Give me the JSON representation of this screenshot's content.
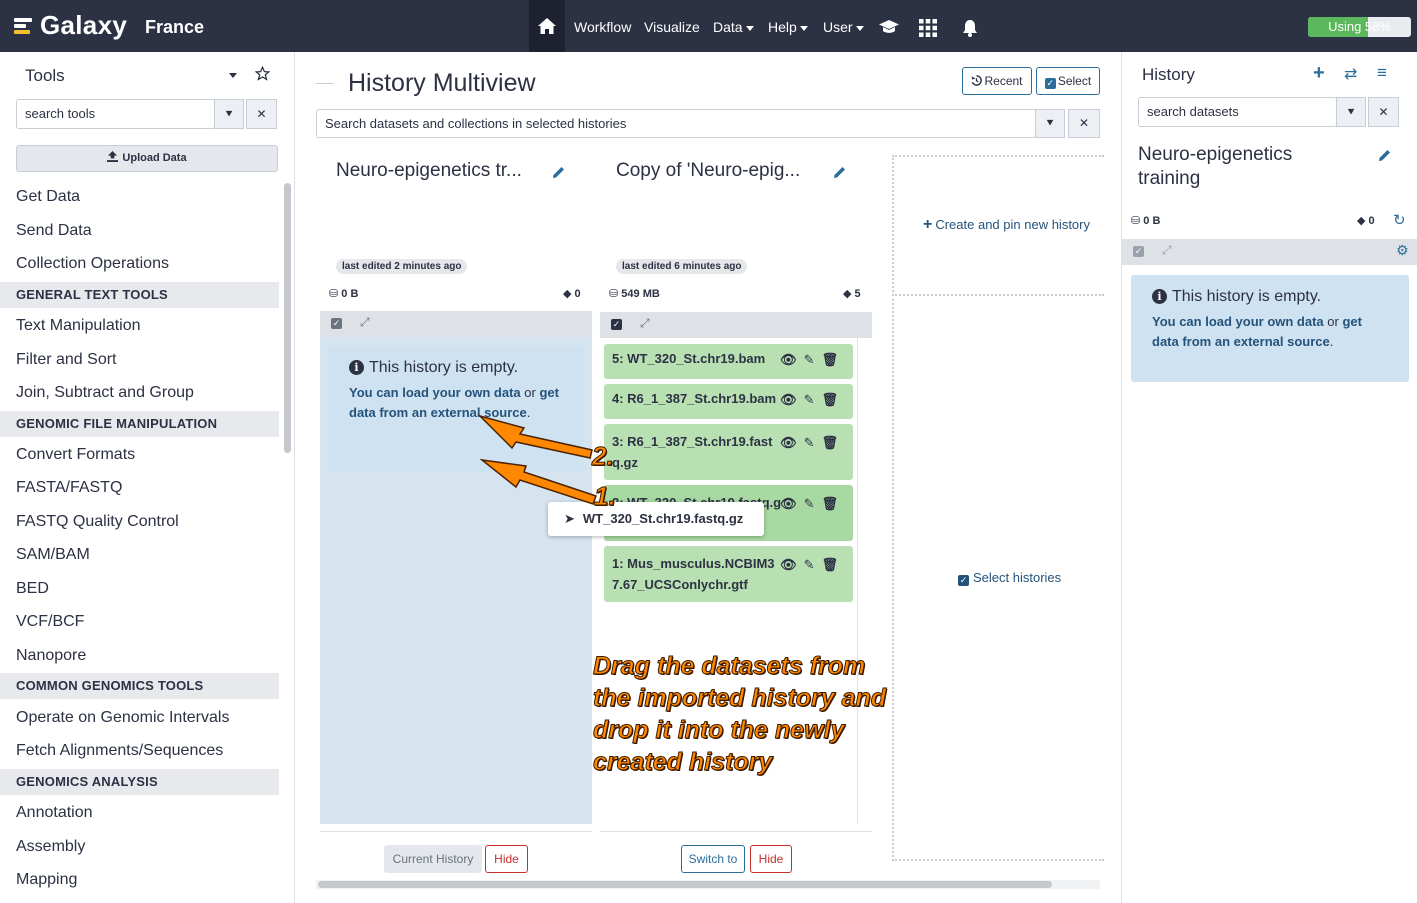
{
  "navbar": {
    "brand": "Galaxy",
    "subsite": "France",
    "menu": [
      "Workflow",
      "Visualize",
      "Data",
      "Help",
      "User"
    ],
    "usage_label": "Using 58%",
    "usage_fraction": 0.58
  },
  "tools": {
    "title": "Tools",
    "search_value": "search tools",
    "upload_label": "Upload Data",
    "items_top": [
      "Get Data",
      "Send Data",
      "Collection Operations"
    ],
    "section1": "GENERAL TEXT TOOLS",
    "items_s1": [
      "Text Manipulation",
      "Filter and Sort",
      "Join, Subtract and Group"
    ],
    "section2": "GENOMIC FILE MANIPULATION",
    "items_s2": [
      "Convert Formats",
      "FASTA/FASTQ",
      "FASTQ Quality Control",
      "SAM/BAM",
      "BED",
      "VCF/BCF",
      "Nanopore"
    ],
    "section3": "COMMON GENOMICS TOOLS",
    "items_s3": [
      "Operate on Genomic Intervals",
      "Fetch Alignments/Sequences"
    ],
    "section4": "GENOMICS ANALYSIS",
    "items_s4": [
      "Annotation",
      "Assembly",
      "Mapping"
    ]
  },
  "center": {
    "title": "History Multiview",
    "recent_label": "Recent",
    "select_label": "Select",
    "search_value": "Search datasets and collections in selected histories",
    "history1": {
      "name": "Neuro-epigenetics tr...",
      "edited": "last edited 2 minutes ago",
      "size": "0 B",
      "count": "0",
      "empty_title": "This history is empty.",
      "empty_link1": "You can load your own data",
      "empty_or": " or ",
      "empty_link2": "get data from an external source",
      "empty_end": ".",
      "current_label": "Current History",
      "hide_label": "Hide"
    },
    "history2": {
      "name": "Copy of 'Neuro-epig...",
      "edited": "last edited 6 minutes ago",
      "size": "549 MB",
      "count": "5",
      "datasets": [
        "5: WT_320_St.chr19.bam",
        "4: R6_1_387_St.chr19.bam",
        "3: R6_1_387_St.chr19.fastq.gz",
        "2: WT_320_St.chr19.fastq.gz",
        "1: Mus_musculus.NCBIM37.67_UCSConlychr.gtf"
      ],
      "switch_label": "Switch to",
      "hide_label": "Hide"
    },
    "drag_label": "WT_320_St.chr19.fastq.gz",
    "create_label": "Create and pin new history",
    "select_histories_label": "Select histories",
    "annotation_1": "1.",
    "annotation_2": "2.",
    "annotation_text": [
      "Drag the datasets from",
      "the imported history and",
      "drop it into the newly",
      "created history"
    ]
  },
  "right": {
    "title": "History",
    "search_value": "search datasets",
    "name_line1": "Neuro-epigenetics",
    "name_line2": "training",
    "size": "0 B",
    "count": "0",
    "empty_title": "This history is empty.",
    "empty_link1": "You can load your own data",
    "empty_or": " or ",
    "empty_link2": "get data from an external source",
    "empty_end": "."
  },
  "colors": {
    "navbar": "#2c3143",
    "accent": "#2c6e9b",
    "dataset_ok": "#b9e0b3",
    "empty_info": "#cfe2f1",
    "annotation": "#ff8800"
  }
}
